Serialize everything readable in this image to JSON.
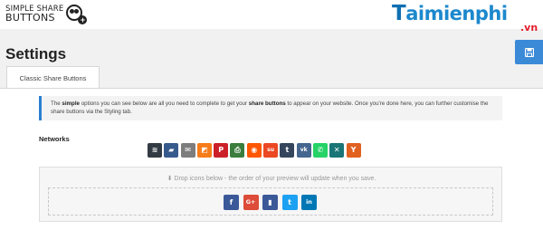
{
  "header": {
    "logo_line1": "SIMPLE SHARE",
    "logo_line2": "BUTTONS",
    "watermark": "aimienphi",
    "watermark_initial": "T",
    "watermark_suffix": ".vn"
  },
  "page": {
    "title": "Settings",
    "save_icon": "floppy-disk-icon"
  },
  "tabs": [
    {
      "label": "Classic Share Buttons",
      "active": true
    }
  ],
  "notice": {
    "text_1": "The ",
    "bold_1": "simple",
    "text_2": " options you can see below are all you need to complete to get your ",
    "bold_2": "share buttons",
    "text_3": " to appear on your website. Once you're done here, you can further customise the share buttons via the Styling tab."
  },
  "networks": {
    "label": "Networks",
    "buttons": [
      {
        "name": "buffer",
        "glyph": "≋",
        "color": "#323b43"
      },
      {
        "name": "diggit",
        "glyph": "▰",
        "color": "#375a8c"
      },
      {
        "name": "email",
        "glyph": "✉",
        "color": "#7d7d7d"
      },
      {
        "name": "flattr",
        "glyph": "◩",
        "color": "#f67c1a"
      },
      {
        "name": "pinterest",
        "glyph": "P",
        "color": "#cb2027"
      },
      {
        "name": "print",
        "glyph": "⎙",
        "color": "#3b7d3d"
      },
      {
        "name": "reddit",
        "glyph": "◉",
        "color": "#ff5700"
      },
      {
        "name": "stumbleupon",
        "glyph": "su",
        "color": "#eb4823"
      },
      {
        "name": "tumblr",
        "glyph": "t",
        "color": "#35465c"
      },
      {
        "name": "vk",
        "glyph": "vk",
        "color": "#45668e"
      },
      {
        "name": "whatsapp",
        "glyph": "✆",
        "color": "#25d366"
      },
      {
        "name": "xing",
        "glyph": "✕",
        "color": "#1a7576"
      },
      {
        "name": "yummly",
        "glyph": "Y",
        "color": "#e16120"
      }
    ]
  },
  "preview": {
    "drop_text": "Drop icons below - the order of your preview will update when you save.",
    "buttons": [
      {
        "name": "facebook",
        "glyph": "f",
        "color": "#3b5998"
      },
      {
        "name": "google-plus",
        "glyph": "G+",
        "color": "#dd4b39"
      },
      {
        "name": "bookmark",
        "glyph": "▮",
        "color": "#3b5998"
      },
      {
        "name": "twitter",
        "glyph": "t",
        "color": "#1da1f2"
      },
      {
        "name": "linkedin",
        "glyph": "in",
        "color": "#0077b5"
      }
    ]
  }
}
